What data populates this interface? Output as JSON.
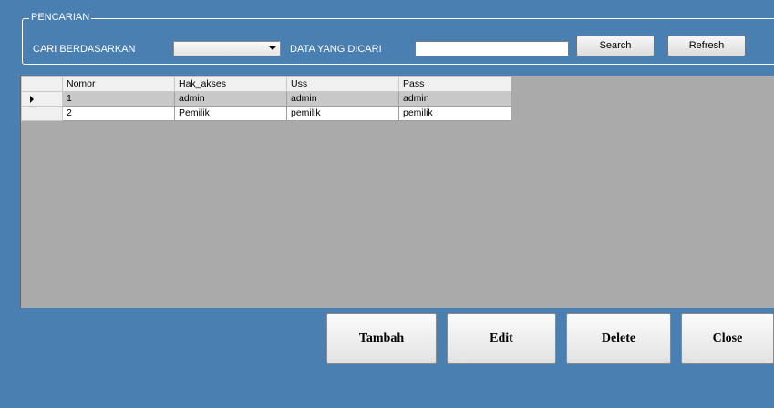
{
  "search_group": {
    "title": "PENCARIAN",
    "search_by_label": "CARI BERDASARKAN",
    "search_by_value": "",
    "query_label": "DATA YANG DICARI",
    "query_value": "",
    "search_button": "Search",
    "refresh_button": "Refresh"
  },
  "grid": {
    "columns": [
      "Nomor",
      "Hak_akses",
      "Uss",
      "Pass"
    ],
    "rows": [
      {
        "nomor": "1",
        "hak_akses": "admin",
        "uss": "admin",
        "pass": "admin"
      },
      {
        "nomor": "2",
        "hak_akses": "Pemilik",
        "uss": "pemilik",
        "pass": "pemilik"
      }
    ]
  },
  "actions": {
    "tambah": "Tambah",
    "edit": "Edit",
    "delete": "Delete",
    "close": "Close"
  }
}
